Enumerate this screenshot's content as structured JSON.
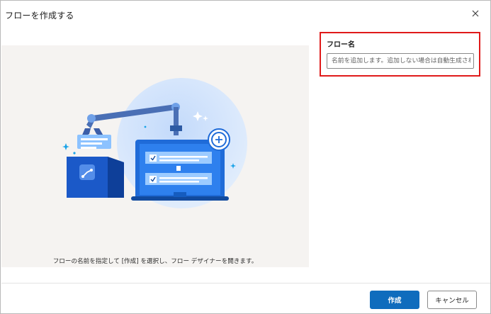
{
  "dialog": {
    "title": "フローを作成する",
    "close_icon": "close-icon"
  },
  "illustration": {
    "caption": "フローの名前を指定して [作成] を選択し、フロー デザイナーを開きます。",
    "icons": [
      "robot-arm",
      "monitor",
      "list-checkbox",
      "plus-circle",
      "box",
      "sparkle"
    ]
  },
  "flow_name": {
    "label": "フロー名",
    "value": "",
    "placeholder": "名前を追加します。追加しない場合は自動生成されます"
  },
  "footer": {
    "create_label": "作成",
    "cancel_label": "キャンセル"
  },
  "colors": {
    "primary": "#0f6cbd",
    "highlight_border": "#e01a1a",
    "panel_bg": "#f5f3f1"
  }
}
